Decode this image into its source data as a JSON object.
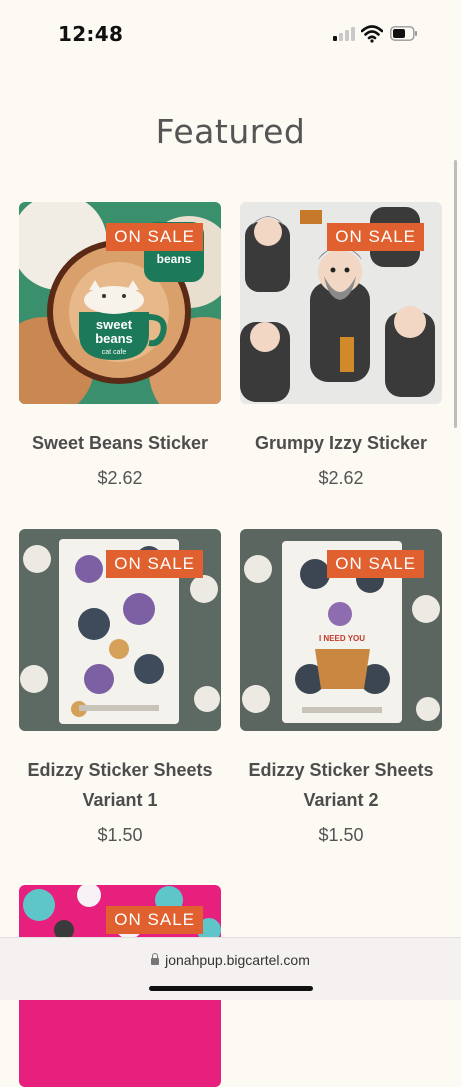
{
  "status_bar": {
    "time": "12:48"
  },
  "page": {
    "title": "Featured"
  },
  "products": [
    {
      "name": "Sweet Beans Sticker",
      "price": "$2.62",
      "badge": "ON SALE",
      "art_text": [
        "sweet",
        "beans",
        "cat cafe"
      ]
    },
    {
      "name": "Grumpy Izzy Sticker",
      "price": "$2.62",
      "badge": "ON SALE"
    },
    {
      "name": "Edizzy Sticker Sheets Variant 1",
      "price": "$1.50",
      "badge": "ON SALE"
    },
    {
      "name": "Edizzy Sticker Sheets Variant 2",
      "price": "$1.50",
      "badge": "ON SALE",
      "art_text": [
        "I NEED YOU"
      ]
    },
    {
      "name": "",
      "price": "",
      "badge": "ON SALE"
    }
  ],
  "browser": {
    "url": "jonahpup.bigcartel.com"
  },
  "colors": {
    "accent": "#e0612f",
    "background": "#fdfaf3",
    "sweet_beans_green": "#1c7a5a"
  }
}
